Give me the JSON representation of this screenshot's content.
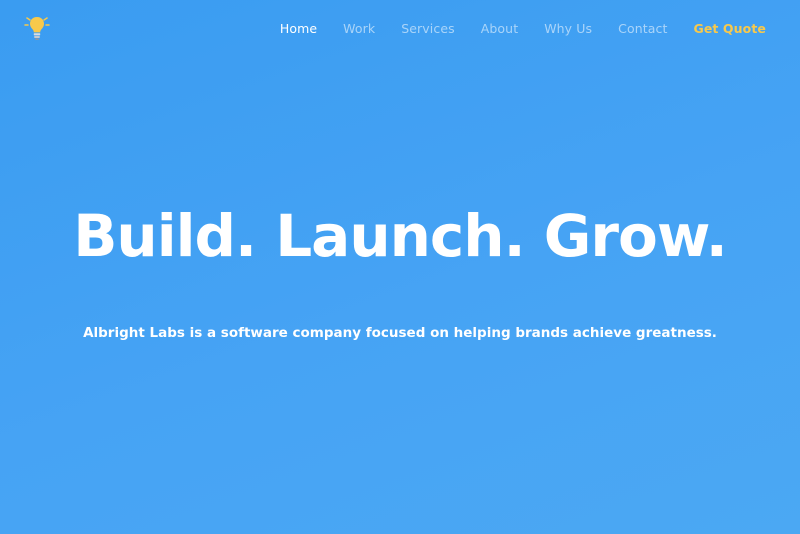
{
  "brand": {
    "logo_icon": "lightbulb-icon",
    "logo_color": "#f8c94b"
  },
  "nav": {
    "items": [
      {
        "label": "Home",
        "state": "active"
      },
      {
        "label": "Work"
      },
      {
        "label": "Services"
      },
      {
        "label": "About"
      },
      {
        "label": "Why Us"
      },
      {
        "label": "Contact"
      }
    ],
    "cta_label": "Get Quote"
  },
  "hero": {
    "headline": "Build. Launch. Grow.",
    "subtitle": "Albright Labs is a software company focused on helping brands achieve greatness.",
    "background_color": "#44a1f3",
    "accent_color": "#f8c94b"
  }
}
